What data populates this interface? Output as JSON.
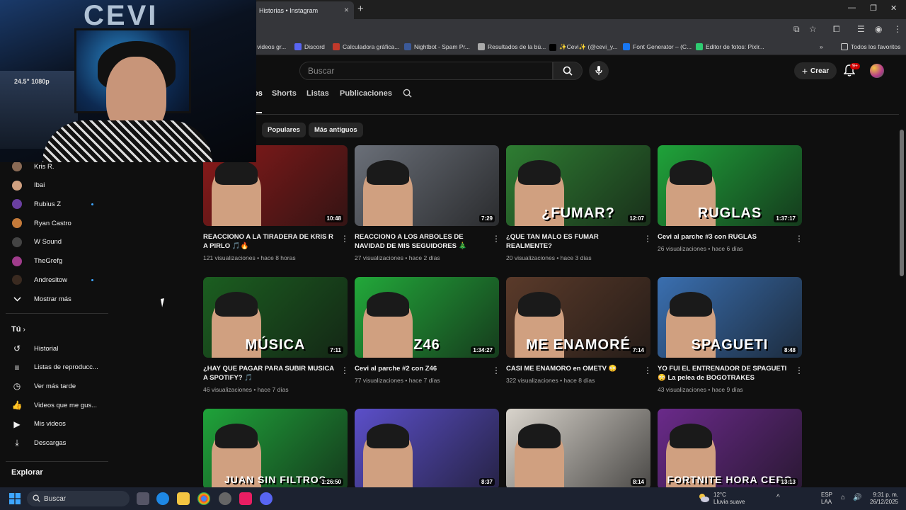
{
  "browser": {
    "tab_title": "Historias • Instagram",
    "bookmarks": [
      {
        "label": "r videos gr...",
        "color": "#888888"
      },
      {
        "label": "Discord",
        "color": "#5865f2"
      },
      {
        "label": "Calculadora gráfica...",
        "color": "#c0392b"
      },
      {
        "label": "Nightbot - Spam Pr...",
        "color": "#3b5998"
      },
      {
        "label": "Resultados de la bú...",
        "color": "#aaaaaa"
      },
      {
        "label": "✨Cevi✨ (@cevi_y...",
        "color": "#000000"
      },
      {
        "label": "Font Generator – (C...",
        "color": "#1877f2"
      },
      {
        "label": "Editor de fotos: Pixlr...",
        "color": "#2ecc71"
      }
    ],
    "favorites_label": "Todos los favoritos"
  },
  "header": {
    "search_placeholder": "Buscar",
    "create_label": "Crear",
    "notif_badge": "9+"
  },
  "channel_tabs": {
    "videos": "os",
    "shorts": "Shorts",
    "lists": "Listas",
    "posts": "Publicaciones"
  },
  "chips": {
    "popular": "Populares",
    "oldest": "Más antiguos"
  },
  "sidebar": {
    "subscriptions": [
      {
        "name": "Kris R.",
        "color": "#8a6a55",
        "dot": false
      },
      {
        "name": "Ibai",
        "color": "#d0a080",
        "dot": false
      },
      {
        "name": "Rubius Z",
        "color": "#6a3fa0",
        "dot": true
      },
      {
        "name": "Ryan Castro",
        "color": "#c47a3a",
        "dot": false
      },
      {
        "name": "W Sound",
        "color": "#444444",
        "dot": false
      },
      {
        "name": "TheGrefg",
        "color": "#a03c8c",
        "dot": false
      },
      {
        "name": "Andresitow",
        "color": "#3a2a20",
        "dot": true
      }
    ],
    "show_more": "Mostrar más",
    "you_heading": "Tú",
    "you_items": [
      {
        "label": "Historial",
        "icon": "history-icon"
      },
      {
        "label": "Listas de reproducc...",
        "icon": "playlist-icon"
      },
      {
        "label": "Ver más tarde",
        "icon": "watch-later-icon"
      },
      {
        "label": "Videos que me gus...",
        "icon": "thumbs-up-icon"
      },
      {
        "label": "Mis videos",
        "icon": "my-videos-icon"
      },
      {
        "label": "Descargas",
        "icon": "download-icon"
      }
    ],
    "explore_heading": "Explorar"
  },
  "webcam": {
    "sign_text": "CEVI",
    "monitor_label": "24.5\" 1080p"
  },
  "videos": [
    {
      "title": "REACCIONO A LA TIRADERA DE KRIS R A PIRLO 🎵🔥",
      "views": "121 visualizaciones",
      "age": "hace 8 horas",
      "duration": "10:48",
      "bg": "#8a1a1a",
      "overlay": ""
    },
    {
      "title": "REACCIONO A LOS ARBOLES DE NAVIDAD DE MIS SEGUIDORES 🎄",
      "views": "27 visualizaciones",
      "age": "hace 2 días",
      "duration": "7:29",
      "bg": "#6a6f78",
      "overlay": ""
    },
    {
      "title": "¿QUE TAN MALO ES FUMAR REALMENTE?",
      "views": "20 visualizaciones",
      "age": "hace 3 días",
      "duration": "12:07",
      "bg": "#2e7d32",
      "overlay": "¿FUMAR?"
    },
    {
      "title": "Cevi al parche #3 con RUGLAS",
      "views": "26 visualizaciones",
      "age": "hace 6 días",
      "duration": "1:37:17",
      "bg": "#1fa33a",
      "overlay": "RUGLAS"
    },
    {
      "title": "¿HAY QUE PAGAR PARA SUBIR MUSICA A SPOTIFY? 🎵",
      "views": "46 visualizaciones",
      "age": "hace 7 días",
      "duration": "7:11",
      "bg": "#1b5e20",
      "overlay": "MÚSICA"
    },
    {
      "title": "Cevi al parche #2 con Z46",
      "views": "77 visualizaciones",
      "age": "hace 7 días",
      "duration": "1:34:27",
      "bg": "#22a83a",
      "overlay": "Z46"
    },
    {
      "title": "CASI ME ENAMORO en OMETV 😳",
      "views": "322 visualizaciones",
      "age": "hace 8 días",
      "duration": "7:14",
      "bg": "#5a3a2a",
      "overlay": "ME ENAMORÉ"
    },
    {
      "title": "YO FUI EL ENTRENADOR DE SPAGUETI 😳 La pelea de BOGOTRAKES",
      "views": "43 visualizaciones",
      "age": "hace 9 días",
      "duration": "8:48",
      "bg": "#3a6fb0",
      "overlay": "SPAGUETI"
    },
    {
      "title": "",
      "views": "",
      "age": "",
      "duration": "1:26:50",
      "bg": "#1fa33a",
      "overlay": "JUAN SIN FILTROS"
    },
    {
      "title": "",
      "views": "",
      "age": "",
      "duration": "8:37",
      "bg": "#5b4fc9",
      "overlay": ""
    },
    {
      "title": "",
      "views": "",
      "age": "",
      "duration": "8:14",
      "bg": "#d9d4cc",
      "overlay": ""
    },
    {
      "title": "",
      "views": "",
      "age": "",
      "duration": "13:13",
      "bg": "#6a2a8a",
      "overlay": "FORTNITE HORA CERO"
    }
  ],
  "taskbar": {
    "search_label": "Buscar",
    "weather_temp": "12°C",
    "weather_desc": "Lluvia suave",
    "lang": "ESP",
    "lang2": "LAA",
    "time": "9:31 p. m.",
    "date": "26/12/2025"
  }
}
